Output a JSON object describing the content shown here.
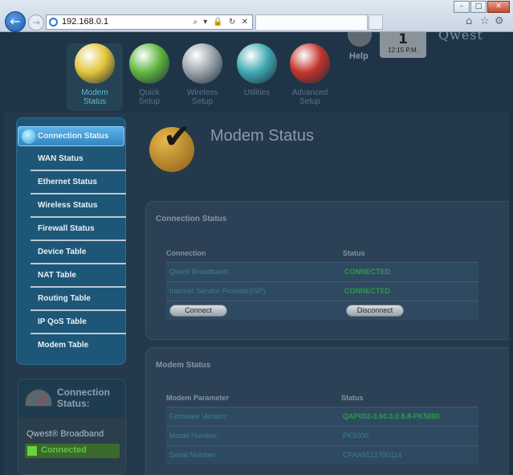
{
  "browser": {
    "address": "192.168.0.1",
    "address_tools": "⌕ ▾ 🔒 ↻ ✕",
    "window_buttons": [
      "–",
      "□",
      "✕"
    ],
    "toolbar_icons": [
      "home-icon",
      "star-icon",
      "gear-icon"
    ]
  },
  "header": {
    "brand": "Qwest",
    "help_label": "Help",
    "clock_number": "1",
    "clock_time": "12:15 P.M.",
    "nav": [
      {
        "label_line1": "Modem",
        "label_line2": "Status",
        "color": "#e2c43a",
        "active": true
      },
      {
        "label_line1": "Quick",
        "label_line2": "Setup",
        "color": "#5fb63f",
        "active": false
      },
      {
        "label_line1": "Wireless",
        "label_line2": "Setup",
        "color": "#9aa3ab",
        "active": false
      },
      {
        "label_line1": "Utilities",
        "label_line2": "",
        "color": "#3fa9b3",
        "active": false
      },
      {
        "label_line1": "Advanced",
        "label_line2": "Setup",
        "color": "#c3342b",
        "active": false
      }
    ]
  },
  "sidebar": {
    "items": [
      {
        "label": "Connection Status"
      },
      {
        "label": "WAN Status"
      },
      {
        "label": "Ethernet Status"
      },
      {
        "label": "Wireless Status"
      },
      {
        "label": "Firewall Status"
      },
      {
        "label": "Device Table"
      },
      {
        "label": "NAT Table"
      },
      {
        "label": "Routing Table"
      },
      {
        "label": "IP QoS Table"
      },
      {
        "label": "Modem Table"
      }
    ]
  },
  "conn_widget": {
    "title_line1": "Connection",
    "title_line2": "Status:",
    "service": "Qwest® Broadband",
    "status": "Connected"
  },
  "main": {
    "title": "Modem Status",
    "connection_panel": {
      "title": "Connection Status",
      "col1": "Connection",
      "col2": "Status",
      "rows": [
        {
          "name": "Qwest Broadband:",
          "status": "CONNECTED"
        },
        {
          "name": "Internet Service Provider(ISP):",
          "status": "CONNECTED"
        }
      ],
      "connect_label": "Connect",
      "disconnect_label": "Disconnect"
    },
    "modem_panel": {
      "title": "Modem Status",
      "col1": "Modem Parameter",
      "col2": "Status",
      "rows": [
        {
          "name": "Firmware Version:",
          "value": "QAP002-3.60.3.0.8.8-PK5000"
        },
        {
          "name": "Model Number:",
          "value": "PK5000"
        },
        {
          "name": "Serial Number:",
          "value": "CPAA9121700114"
        }
      ]
    }
  }
}
